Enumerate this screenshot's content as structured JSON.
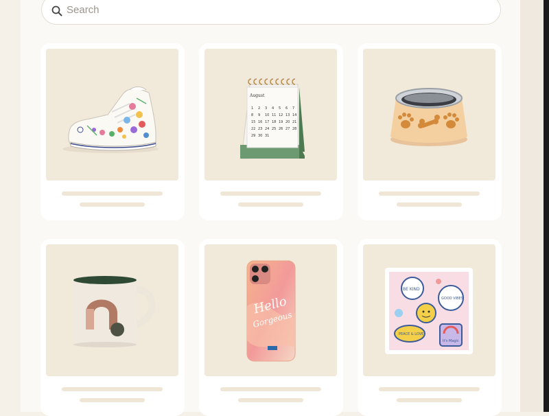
{
  "search": {
    "placeholder": "Search",
    "icon": "search-icon"
  },
  "products": [
    {
      "icon": "sneaker-icon"
    },
    {
      "icon": "desk-calendar-icon",
      "month_label": "August"
    },
    {
      "icon": "pet-bowl-icon"
    },
    {
      "icon": "mug-icon"
    },
    {
      "icon": "phone-case-icon",
      "case_text_1": "Hello",
      "case_text_2": "Gorgeous"
    },
    {
      "icon": "sticker-sheet-icon",
      "sticker_texts": [
        "BE KIND",
        "GOOD VIBES",
        "PEACE & LOVE",
        "It's Magic"
      ]
    }
  ],
  "colors": {
    "background": "#f5f0e8",
    "panel": "#fbf9f5",
    "card": "#ffffff",
    "thumb": "#f1e9da",
    "placeholder_line": "#efe6d5"
  }
}
